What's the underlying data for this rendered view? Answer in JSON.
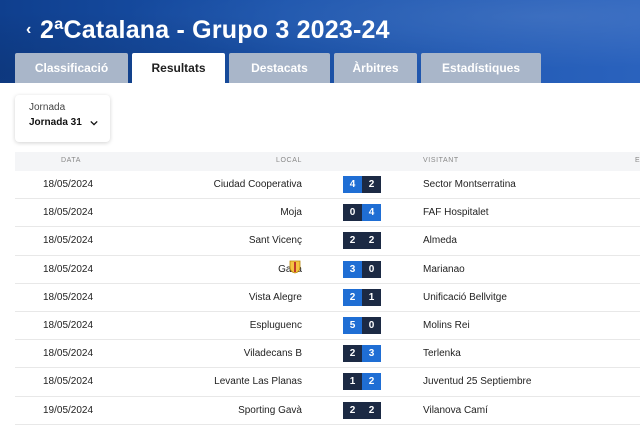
{
  "header": {
    "title": "2ªCatalana - Grupo 3 2023-24",
    "back_icon": "chevron-left-icon"
  },
  "tabs": [
    {
      "label": "Classificació",
      "active": false
    },
    {
      "label": "Resultats",
      "active": true
    },
    {
      "label": "Destacats",
      "active": false
    },
    {
      "label": "Àrbitres",
      "active": false
    },
    {
      "label": "Estadístiques",
      "active": false
    }
  ],
  "jornada": {
    "label": "Jornada",
    "selected": "Jornada 31"
  },
  "table": {
    "columns": {
      "data": "DATA",
      "local": "LOCAL",
      "visitant": "VISITANT",
      "extra": "E"
    },
    "rows": [
      {
        "date": "18/05/2024",
        "local": "Ciudad Cooperativa",
        "home": "4",
        "away": "2",
        "visitant": "Sector Montserratina"
      },
      {
        "date": "18/05/2024",
        "local": "Moja",
        "home": "0",
        "away": "4",
        "visitant": "FAF Hospitalet"
      },
      {
        "date": "18/05/2024",
        "local": "Sant Vicenç",
        "home": "2",
        "away": "2",
        "visitant": "Almeda"
      },
      {
        "date": "18/05/2024",
        "local": "Gavà",
        "home": "3",
        "away": "0",
        "visitant": "Marianao"
      },
      {
        "date": "18/05/2024",
        "local": "Vista Alegre",
        "home": "2",
        "away": "1",
        "visitant": "Unificació Bellvitge"
      },
      {
        "date": "18/05/2024",
        "local": "Espluguenc",
        "home": "5",
        "away": "0",
        "visitant": "Molins Rei"
      },
      {
        "date": "18/05/2024",
        "local": "Viladecans B",
        "home": "2",
        "away": "3",
        "visitant": "Terlenka"
      },
      {
        "date": "18/05/2024",
        "local": "Levante Las Planas",
        "home": "1",
        "away": "2",
        "visitant": "Juventud 25 Septiembre"
      },
      {
        "date": "19/05/2024",
        "local": "Sporting Gavà",
        "home": "2",
        "away": "2",
        "visitant": "Vilanova Camí"
      }
    ]
  },
  "colors": {
    "header": "#1b54ad",
    "tab_inactive": "#a9b6c9",
    "score_win": "#1f6ed4",
    "score_dark": "#1c2a44"
  }
}
